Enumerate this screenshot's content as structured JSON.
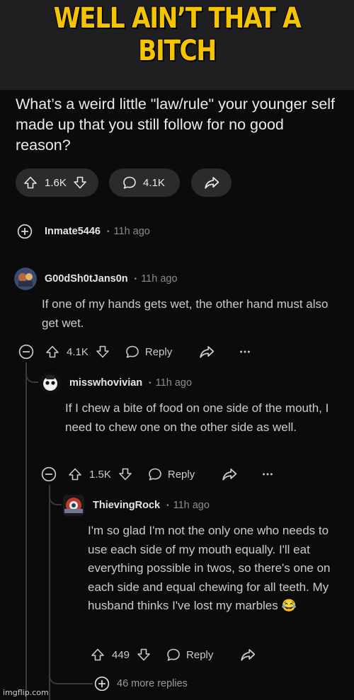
{
  "meme": {
    "caption": "WELL AIN’T THAT A BITCH"
  },
  "post": {
    "title": "What’s a weird little \"law/rule\" your younger self made up that you still follow for no good reason?",
    "votes": "1.6K",
    "comments": "4.1K"
  },
  "collapsed_comment": {
    "username": "Inmate5446",
    "time": "11h ago"
  },
  "comments": [
    {
      "username": "G00dSh0tJans0n",
      "time": "11h ago",
      "body": "If one of my hands gets wet, the other hand must also get wet.",
      "votes": "4.1K",
      "reply_label": "Reply"
    },
    {
      "username": "misswhovivian",
      "time": "11h ago",
      "body": "If I chew a bite of food on one side of the mouth, I need to chew one on the other side as well.",
      "votes": "1.5K",
      "reply_label": "Reply"
    },
    {
      "username": "ThievingRock",
      "time": "11h ago",
      "body": "I'm so glad I'm not the only one who needs to use each side of my mouth equally. I'll eat everything possible in twos, so there's one on each side and equal chewing for all teeth. My husband thinks I've lost my marbles 😂",
      "votes": "449",
      "reply_label": "Reply"
    }
  ],
  "more_replies": "46 more replies",
  "watermark": "imgflip.com",
  "colors": {
    "caption": "#f5c400",
    "background": "#0b0b0b",
    "pill": "#2b2b2d"
  }
}
